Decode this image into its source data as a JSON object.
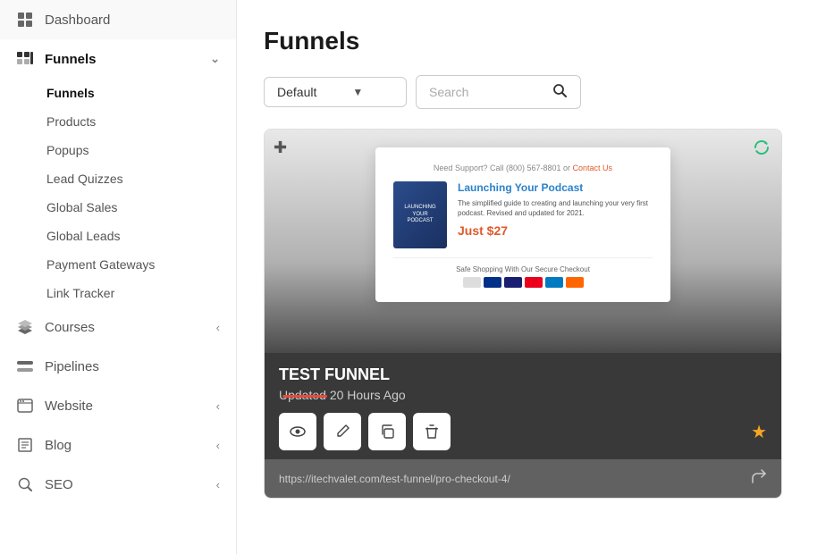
{
  "sidebar": {
    "items": [
      {
        "id": "dashboard",
        "label": "Dashboard",
        "icon": "dashboard-icon",
        "hasChevron": false,
        "active": false
      },
      {
        "id": "funnels",
        "label": "Funnels",
        "icon": "funnels-icon",
        "hasChevron": true,
        "chevronDir": "down",
        "active": true
      },
      {
        "id": "courses",
        "label": "Courses",
        "icon": "courses-icon",
        "hasChevron": true,
        "chevronDir": "left",
        "active": false
      },
      {
        "id": "pipelines",
        "label": "Pipelines",
        "icon": "pipelines-icon",
        "hasChevron": false,
        "active": false
      },
      {
        "id": "website",
        "label": "Website",
        "icon": "website-icon",
        "hasChevron": true,
        "chevronDir": "left",
        "active": false
      },
      {
        "id": "blog",
        "label": "Blog",
        "icon": "blog-icon",
        "hasChevron": true,
        "chevronDir": "left",
        "active": false
      },
      {
        "id": "seo",
        "label": "SEO",
        "icon": "seo-icon",
        "hasChevron": true,
        "chevronDir": "left",
        "active": false
      }
    ],
    "sub_items": [
      {
        "id": "funnels-sub",
        "label": "Funnels",
        "active": true
      },
      {
        "id": "products",
        "label": "Products",
        "active": false
      },
      {
        "id": "popups",
        "label": "Popups",
        "active": false
      },
      {
        "id": "lead-quizzes",
        "label": "Lead Quizzes",
        "active": false
      },
      {
        "id": "global-sales",
        "label": "Global Sales",
        "active": false
      },
      {
        "id": "global-leads",
        "label": "Global Leads",
        "active": false
      },
      {
        "id": "payment-gateways",
        "label": "Payment Gateways",
        "active": false
      },
      {
        "id": "link-tracker",
        "label": "Link Tracker",
        "active": false
      }
    ]
  },
  "main": {
    "page_title": "Funnels",
    "toolbar": {
      "dropdown_label": "Default",
      "search_placeholder": "Search"
    },
    "funnel_card": {
      "name": "TEST FUNNEL",
      "updated": "Updated 20 Hours Ago",
      "url": "https://itechvalet.com/test-funnel/pro-checkout-4/",
      "preview": {
        "header_text": "Need Support? Call (800) 567-8801 or Contact Us",
        "title": "Launching Your Podcast",
        "description": "The simplified guide to creating and launching your very first podcast. Revised and updated for 2021.",
        "price": "Just $27",
        "footer_text": "Safe Shopping With Our Secure Checkout"
      },
      "actions": [
        {
          "id": "view",
          "icon": "eye-icon"
        },
        {
          "id": "edit",
          "icon": "edit-icon"
        },
        {
          "id": "copy",
          "icon": "copy-icon"
        },
        {
          "id": "delete",
          "icon": "trash-icon"
        }
      ]
    }
  }
}
